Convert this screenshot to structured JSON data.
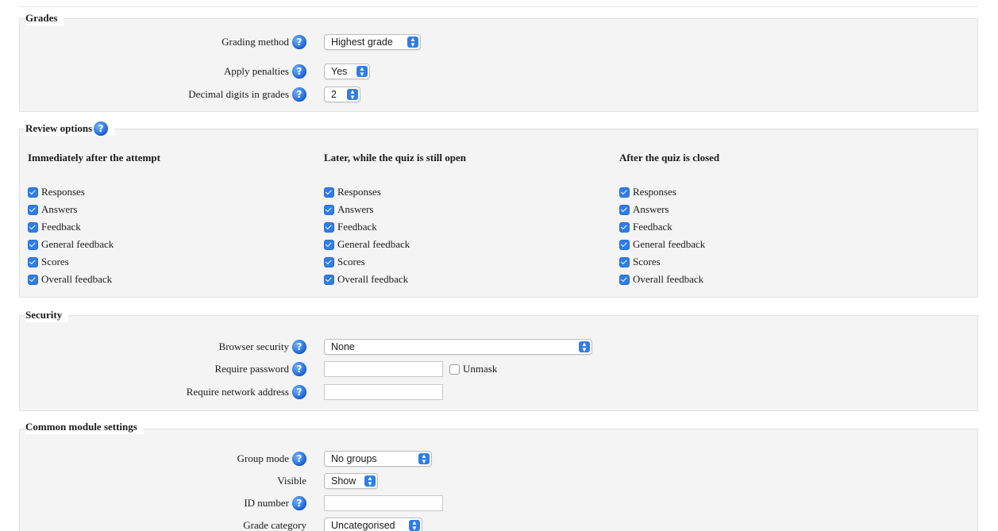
{
  "grades": {
    "legend": "Grades",
    "grading_method_label": "Grading method",
    "grading_method_value": "Highest grade",
    "apply_penalties_label": "Apply penalties",
    "apply_penalties_value": "Yes",
    "decimal_digits_label": "Decimal digits in grades",
    "decimal_digits_value": "2"
  },
  "review": {
    "legend": "Review options",
    "columns": [
      {
        "heading": "Immediately after the attempt",
        "items": [
          {
            "label": "Responses",
            "checked": true
          },
          {
            "label": "Answers",
            "checked": true
          },
          {
            "label": "Feedback",
            "checked": true
          },
          {
            "label": "General feedback",
            "checked": true
          },
          {
            "label": "Scores",
            "checked": true
          },
          {
            "label": "Overall feedback",
            "checked": true
          }
        ]
      },
      {
        "heading": "Later, while the quiz is still open",
        "items": [
          {
            "label": "Responses",
            "checked": true
          },
          {
            "label": "Answers",
            "checked": true
          },
          {
            "label": "Feedback",
            "checked": true
          },
          {
            "label": "General feedback",
            "checked": true
          },
          {
            "label": "Scores",
            "checked": true
          },
          {
            "label": "Overall feedback",
            "checked": true
          }
        ]
      },
      {
        "heading": "After the quiz is closed",
        "items": [
          {
            "label": "Responses",
            "checked": true
          },
          {
            "label": "Answers",
            "checked": true
          },
          {
            "label": "Feedback",
            "checked": true
          },
          {
            "label": "General feedback",
            "checked": true
          },
          {
            "label": "Scores",
            "checked": true
          },
          {
            "label": "Overall feedback",
            "checked": true
          }
        ]
      }
    ]
  },
  "security": {
    "legend": "Security",
    "browser_security_label": "Browser security",
    "browser_security_value": "None",
    "require_password_label": "Require password",
    "require_password_value": "",
    "unmask_label": "Unmask",
    "require_network_label": "Require network address",
    "require_network_value": ""
  },
  "common": {
    "legend": "Common module settings",
    "group_mode_label": "Group mode",
    "group_mode_value": "No groups",
    "visible_label": "Visible",
    "visible_value": "Show",
    "id_number_label": "ID number",
    "id_number_value": "",
    "grade_category_label": "Grade category",
    "grade_category_value": "Uncategorised"
  },
  "icons": {
    "help": "help-icon",
    "select_arrow": "chevron-updown-icon"
  },
  "colors": {
    "accent": "#2f7de6",
    "panel": "#f4f4f4",
    "help_blue": "#1c63d6"
  }
}
